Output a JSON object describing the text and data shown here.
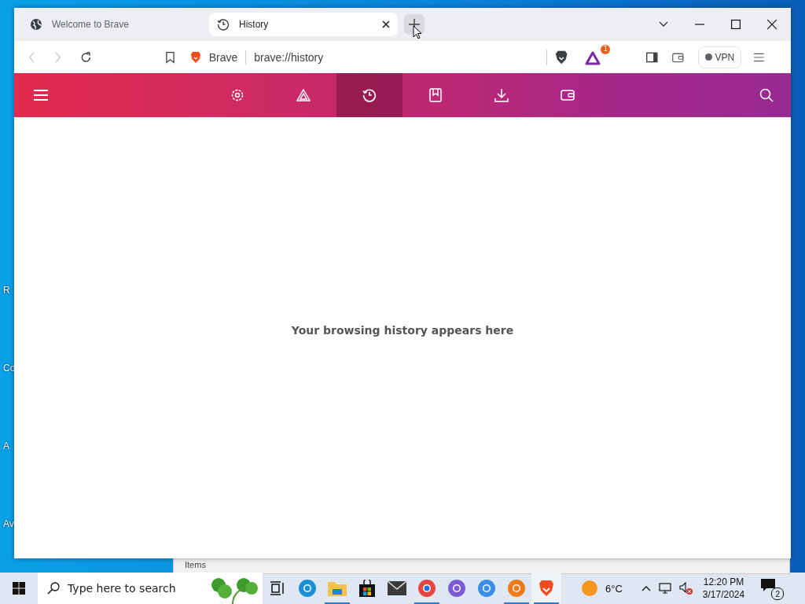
{
  "desktop": {
    "icon_labels": [
      "R",
      "Co",
      "A",
      "Av"
    ],
    "back_window": {
      "status_text": "Items"
    }
  },
  "window": {
    "tabs": [
      {
        "title": "Welcome to Brave",
        "kind": "globe",
        "selected": false
      },
      {
        "title": "History",
        "kind": "history",
        "selected": true
      }
    ],
    "toolbar": {
      "site_label": "Brave",
      "address": "brave://history",
      "rewards_badge": "1",
      "vpn_label": "VPN"
    },
    "page_nav": {
      "items": [
        {
          "kind": "menu",
          "selected": false
        },
        {
          "kind": "settings",
          "selected": false
        },
        {
          "kind": "rewards",
          "selected": false
        },
        {
          "kind": "history",
          "selected": true
        },
        {
          "kind": "bookmarks",
          "selected": false
        },
        {
          "kind": "downloads",
          "selected": false
        },
        {
          "kind": "wallet",
          "selected": false
        },
        {
          "kind": "search",
          "selected": false
        }
      ]
    },
    "empty_message": "Your browsing history appears here"
  },
  "taskbar": {
    "search": {
      "placeholder": "Type here to search"
    },
    "apps": [
      {
        "kind": "taskview",
        "running": false,
        "active": false
      },
      {
        "kind": "edge",
        "running": false,
        "active": false
      },
      {
        "kind": "explorer",
        "running": true,
        "active": false
      },
      {
        "kind": "store",
        "running": false,
        "active": false
      },
      {
        "kind": "mail",
        "running": false,
        "active": false
      },
      {
        "kind": "chrome",
        "running": true,
        "active": false
      },
      {
        "kind": "vpnbrowser",
        "running": false,
        "active": false
      },
      {
        "kind": "secure",
        "running": false,
        "active": false
      },
      {
        "kind": "swift",
        "running": true,
        "active": false
      },
      {
        "kind": "brave",
        "running": true,
        "active": true
      }
    ],
    "weather": "6°C",
    "time": "12:20 PM",
    "date": "3/17/2024",
    "notifications": "2"
  }
}
